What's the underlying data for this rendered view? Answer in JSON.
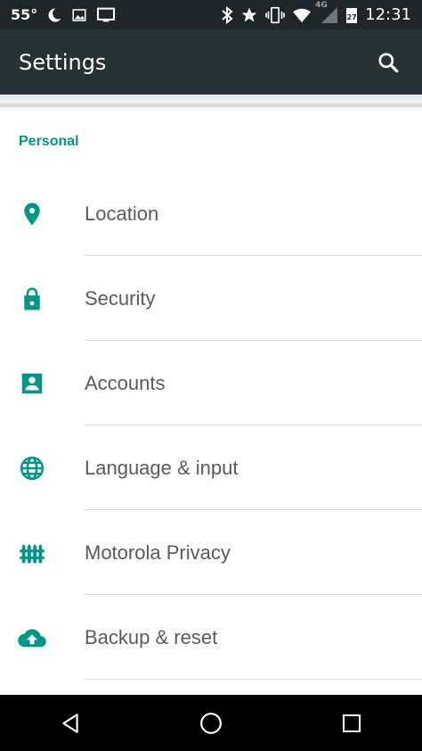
{
  "status_bar": {
    "temperature": "55°",
    "time": "12:31",
    "calendar_day": "27",
    "network": "4G",
    "icons": [
      "moon-icon",
      "image-icon",
      "cast-icon",
      "bluetooth-icon",
      "star-icon",
      "vibrate-icon",
      "wifi-icon",
      "signal-icon",
      "calendar-icon"
    ]
  },
  "toolbar": {
    "title": "Settings",
    "search_icon": "search-icon"
  },
  "personal_section": {
    "header": "Personal",
    "items": [
      {
        "label": "Location",
        "icon": "location-pin-icon"
      },
      {
        "label": "Security",
        "icon": "lock-icon"
      },
      {
        "label": "Accounts",
        "icon": "account-icon"
      },
      {
        "label": "Language & input",
        "icon": "globe-icon"
      },
      {
        "label": "Motorola Privacy",
        "icon": "fence-icon"
      },
      {
        "label": "Backup & reset",
        "icon": "cloud-upload-icon"
      }
    ]
  },
  "nav_bar": {
    "buttons": [
      "back-icon",
      "home-icon",
      "recents-icon"
    ]
  },
  "colors": {
    "accent": "#009688",
    "toolbar_bg": "#263238",
    "status_bg": "#1d262a"
  }
}
